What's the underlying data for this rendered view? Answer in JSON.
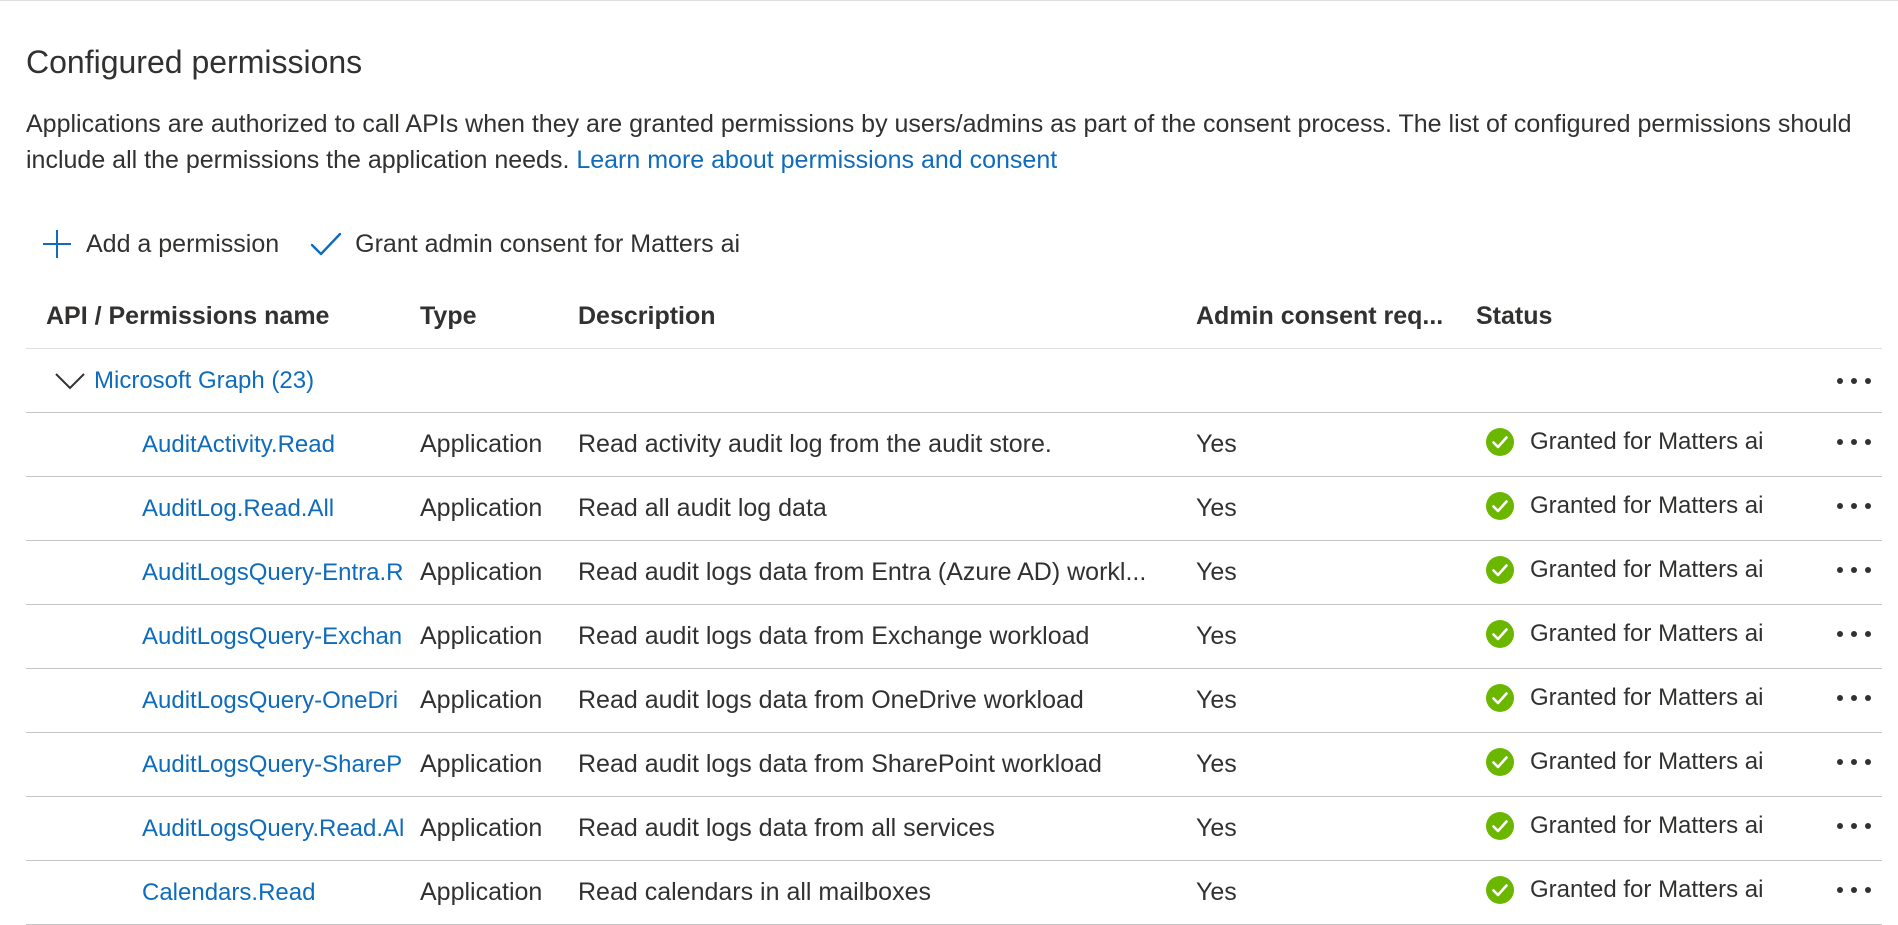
{
  "section": {
    "title": "Configured permissions",
    "intro_text": "Applications are authorized to call APIs when they are granted permissions by users/admins as part of the consent process. The list of configured permissions should include all the permissions the application needs.",
    "learn_more_link": "Learn more about permissions and consent"
  },
  "toolbar": {
    "add_permission_label": "Add a permission",
    "grant_consent_label": "Grant admin consent for Matters ai"
  },
  "table": {
    "columns": {
      "name": "API / Permissions name",
      "type": "Type",
      "description": "Description",
      "admin_consent": "Admin consent req...",
      "status": "Status"
    },
    "group": {
      "label": "Microsoft Graph (23)"
    },
    "rows": [
      {
        "name": "AuditActivity.Read",
        "type": "Application",
        "description": "Read activity audit log from the audit store.",
        "admin_consent": "Yes",
        "status": "Granted for Matters ai"
      },
      {
        "name": "AuditLog.Read.All",
        "type": "Application",
        "description": "Read all audit log data",
        "admin_consent": "Yes",
        "status": "Granted for Matters ai"
      },
      {
        "name": "AuditLogsQuery-Entra.R",
        "type": "Application",
        "description": "Read audit logs data from Entra (Azure AD) workl...",
        "admin_consent": "Yes",
        "status": "Granted for Matters ai"
      },
      {
        "name": "AuditLogsQuery-Exchan",
        "type": "Application",
        "description": "Read audit logs data from Exchange workload",
        "admin_consent": "Yes",
        "status": "Granted for Matters ai"
      },
      {
        "name": "AuditLogsQuery-OneDri",
        "type": "Application",
        "description": "Read audit logs data from OneDrive workload",
        "admin_consent": "Yes",
        "status": "Granted for Matters ai"
      },
      {
        "name": "AuditLogsQuery-ShareP",
        "type": "Application",
        "description": "Read audit logs data from SharePoint workload",
        "admin_consent": "Yes",
        "status": "Granted for Matters ai"
      },
      {
        "name": "AuditLogsQuery.Read.Al",
        "type": "Application",
        "description": "Read audit logs data from all services",
        "admin_consent": "Yes",
        "status": "Granted for Matters ai"
      },
      {
        "name": "Calendars.Read",
        "type": "Application",
        "description": "Read calendars in all mailboxes",
        "admin_consent": "Yes",
        "status": "Granted for Matters ai"
      }
    ]
  },
  "icons": {
    "add": "plus-icon",
    "grant": "checkmark-icon",
    "expand": "chevron-down-icon",
    "more": "more-options-icon",
    "status": "success-check-icon"
  },
  "colors": {
    "link": "#0f6cbd",
    "success": "#6bb700",
    "border": "#c8c6c4"
  }
}
